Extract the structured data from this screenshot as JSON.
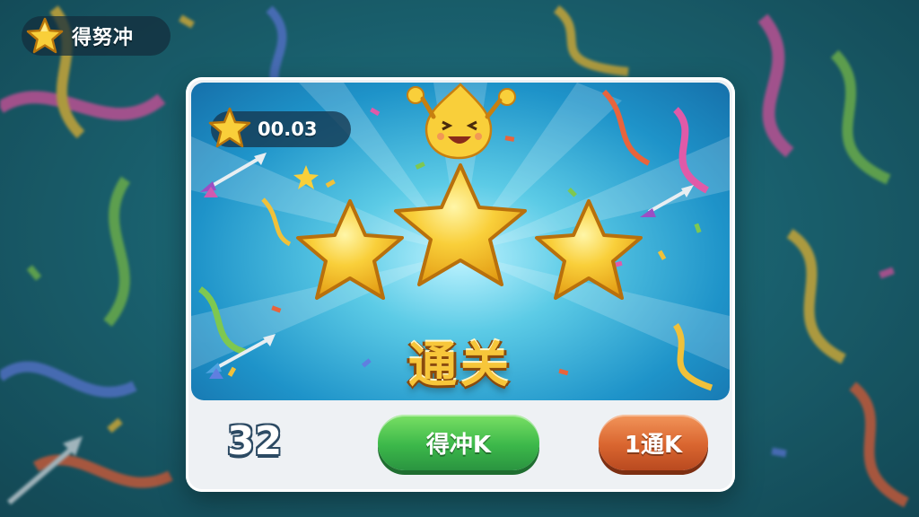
{
  "top_badge": {
    "label": "得努冲",
    "icon": "star-icon"
  },
  "result_card": {
    "score_label": "00.03",
    "star_count": 3,
    "title": "通关",
    "count": "32",
    "primary_button": "得冲K",
    "secondary_button": "1通K"
  },
  "colors": {
    "star_gold": "#f7c63a",
    "primary_green": "#3cb84a",
    "secondary_orange": "#d9652f",
    "banner_blue": "#1e93c9"
  }
}
